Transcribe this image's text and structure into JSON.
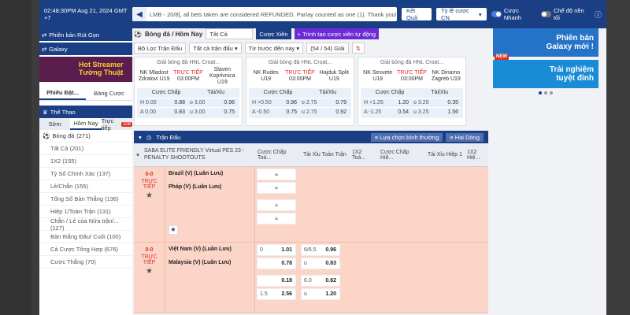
{
  "topbar": {
    "time": "02:48:30PM Aug 21, 2024 GMT +7",
    "ticker": "LMB - 20/8], all bets taken are considered REFUNDED. Parlay counted as one (1). Thank you!",
    "results_btn": "Kết Quả",
    "odds_type": "Tỷ lệ cược CN",
    "quick_bet": "Cược Nhanh",
    "dark_mode": "Chế độ nền tối"
  },
  "left": {
    "btn_rutgon": "Phiên bản Rút Gọn",
    "btn_galaxy": "Galaxy",
    "promo_line1": "Hot Streamer",
    "promo_line2": "Tường Thuật",
    "tab_phieu": "Phiếu Đặt...",
    "tab_bang": "Bảng Cược",
    "sport_head": "Thể Thao",
    "sub_tabs": [
      "Sớm",
      "Hôm Nay",
      "Trực tiếp"
    ],
    "live_badge": "108",
    "sport_name": "Bóng đá",
    "sport_count": "(271)",
    "items": [
      "Tất Cả (201)",
      "1X2 (155)",
      "Tỷ Số Chính Xác (137)",
      "Lẻ/Chẵn (155)",
      "Tổng Số Bàn Thắng (136)",
      "Hiệp 1/Toàn Trận (131)",
      "Chẵn / Lẻ của Nửa trận/... (127)",
      "Bàn thắng Đầu/ Cuối (100)",
      "Cả Cược Tổng Hợp (676)",
      "Cược Thắng (70)"
    ]
  },
  "filters": {
    "sport": "Bóng đá / Hôm Nay",
    "all": "Tất Cả",
    "parlay": "Cược Xiên",
    "create_parlay": "Trình tạo cược xiên tự động",
    "match_filter": "Bộ Lọc Trận Đấu",
    "all_matches": "Tất cả trận đấu",
    "prev": "Từ trước đến nay",
    "count": "(54 / 54) Giải"
  },
  "cards": [
    {
      "league": "Giải bóng đá HNL Croat...",
      "home": "NK Mladost Zdralovi U19",
      "status": "TRỰC TIẾP",
      "time": "03:00PM",
      "away": "Slaven Koprivnica U19",
      "h1": "Cược Chấp",
      "h2": "Tài/Xỉu",
      "r1": [
        "H 0.00",
        "0.88",
        "o 3.00",
        "0.96"
      ],
      "r2": [
        "A 0.00",
        "0.83",
        "u 3.00",
        "0.75"
      ]
    },
    {
      "league": "Giải bóng đá HNL Croat...",
      "home": "NK Rudes U19",
      "status": "TRỰC TIẾP",
      "time": "03:00PM",
      "away": "Hajduk Split U19",
      "h1": "Cược Chấp",
      "h2": "Tài/Xỉu",
      "r1": [
        "H +0.50",
        "0.96",
        "o 2.75",
        "0.79"
      ],
      "r2": [
        "A -0.50",
        "0.75",
        "u 2.75",
        "0.92"
      ]
    },
    {
      "league": "Giải bóng đá HNL Croat...",
      "home": "NK Sesvete U19",
      "status": "TRỰC TIẾP",
      "time": "03:00PM",
      "away": "NK Dinamo Zagreb U19",
      "h1": "Cược Chấp",
      "h2": "Tài/Xỉu",
      "r1": [
        "H +1.25",
        "1.20",
        "o 3.25",
        "0.35"
      ],
      "r2": [
        "A -1.25",
        "0.54",
        "u 3.25",
        "1.56"
      ]
    }
  ],
  "tranbar": {
    "title": "Trận Đấu",
    "sort": "Lựa chọn bình thường",
    "lines": "Hai Dòng"
  },
  "colhead": {
    "league": "SABA ELITE FRIENDLY Virtual PES 23 - PENALTY SHOOTOUTS",
    "c1": "Cược Chấp Toà...",
    "c2": "Tài Xỉu Toàn Trận",
    "c3": "1X2 Toà...",
    "c4": "Cược Chấp Hiệ...",
    "c5": "Tài Xỉu Hiệp 1",
    "c6": "1X2 Hiệ..."
  },
  "match1": {
    "score": "0-0",
    "status": "TRỰC TIẾP",
    "home": "Brazil (V) (Luân Lưu)",
    "away": "Pháp (V) (Luân Lưu)"
  },
  "match2": {
    "score": "0-0",
    "status": "TRỰC TIẾP",
    "home": "Việt Nam (V) (Luân Lưu)",
    "away": "Malaysia (V) (Luân Lưu)",
    "odds": [
      [
        "0",
        "1.01",
        "6/6.5",
        "0.96"
      ],
      [
        "",
        "0.78",
        "u",
        "0.83"
      ],
      [
        "",
        "0.18",
        "6.0",
        "0.62"
      ],
      [
        "1.5",
        "2.56",
        "u",
        "1.20"
      ]
    ]
  },
  "right": {
    "ad1_l1": "Phiên bản",
    "ad1_l2": "Galaxy mới !",
    "ad2_l1": "Trải nghiệm",
    "ad2_l2": "tuyệt đỉnh",
    "new": "NEW"
  }
}
